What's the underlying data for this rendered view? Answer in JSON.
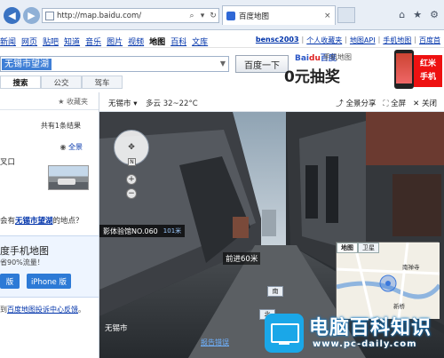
{
  "browser": {
    "url": "http://map.baidu.com/",
    "tab_title": "百度地图",
    "tab_close": "×"
  },
  "topnav": {
    "links": [
      "新闻",
      "网页",
      "贴吧",
      "知道",
      "音乐",
      "图片",
      "视频",
      "地图",
      "百科",
      "文库"
    ],
    "active": "地图",
    "user": "bensc2003",
    "right_links": [
      "个人收藏夹",
      "地图API",
      "手机地图",
      "百度首"
    ]
  },
  "search": {
    "query": "无锡市望湖",
    "button": "百度一下",
    "modes": [
      "搜索",
      "公交",
      "驾车"
    ],
    "selected_mode": "搜索"
  },
  "ad": {
    "brand": "Bai",
    "brand_accent": "du",
    "brand_suffix": "百度",
    "sub": "手机地图",
    "headline": "0元抽奖",
    "promo_line1": "红米",
    "promo_line2": "手机"
  },
  "left_panel": {
    "favorite": "收藏夹",
    "result_count": "共有1条结果",
    "location_link": "全景",
    "address": "叉口",
    "question": {
      "prefix": "会有",
      "highlight": "无锡市望湖",
      "suffix": "的地点？"
    },
    "app": {
      "title": "度手机地图",
      "subtitle": "省90%流量！",
      "btn_android": "版",
      "btn_iphone": "iPhone 版"
    },
    "footer": {
      "prefix": "到",
      "link": "百度地图投诉中心反馈",
      "suffix": "。"
    }
  },
  "map_header": {
    "city": "无锡市",
    "weather": "多云 32~22°C",
    "tools": [
      "全景分享",
      "全屏",
      "关闭"
    ]
  },
  "street_view": {
    "poi_name": "影体验馆NO.060",
    "poi_distance": "101米",
    "forward": "前进60米",
    "arrow_south": "南",
    "arrow_north": "北",
    "city": "无锡市",
    "report": "报告错误",
    "minimap_tabs": [
      "地图",
      "卫星"
    ],
    "minimap_labels": [
      "南禅寺",
      "新桥"
    ]
  },
  "watermark": {
    "name": "电脑百科知识",
    "site": "www.pc-daily.com"
  },
  "colors": {
    "link": "#0033aa",
    "accent_blue": "#2d7ad6",
    "highlight": "#3f7fd6",
    "watermark_badge": "#1aa7e8"
  }
}
